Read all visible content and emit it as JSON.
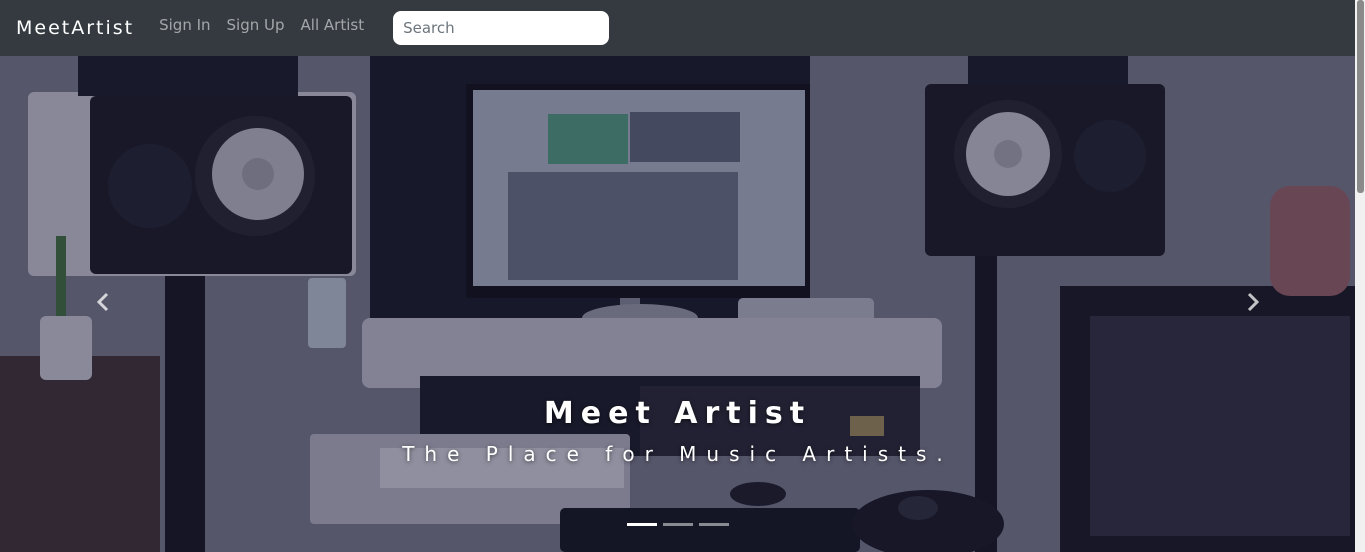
{
  "navbar": {
    "brand": "MeetArtist",
    "links": [
      {
        "label": "Sign In"
      },
      {
        "label": "Sign Up"
      },
      {
        "label": "All Artist"
      }
    ],
    "search": {
      "placeholder": "Search",
      "value": ""
    }
  },
  "carousel": {
    "caption_title": "Meet Artist",
    "caption_subtitle": "The Place for Music Artists.",
    "slide_count": 3,
    "active_slide": 1,
    "prev_icon": "chevron-left-icon",
    "next_icon": "chevron-right-icon"
  },
  "colors": {
    "navbar_bg": "#343a40",
    "nav_link": "rgba(255,255,255,0.55)",
    "brand": "#ffffff"
  }
}
